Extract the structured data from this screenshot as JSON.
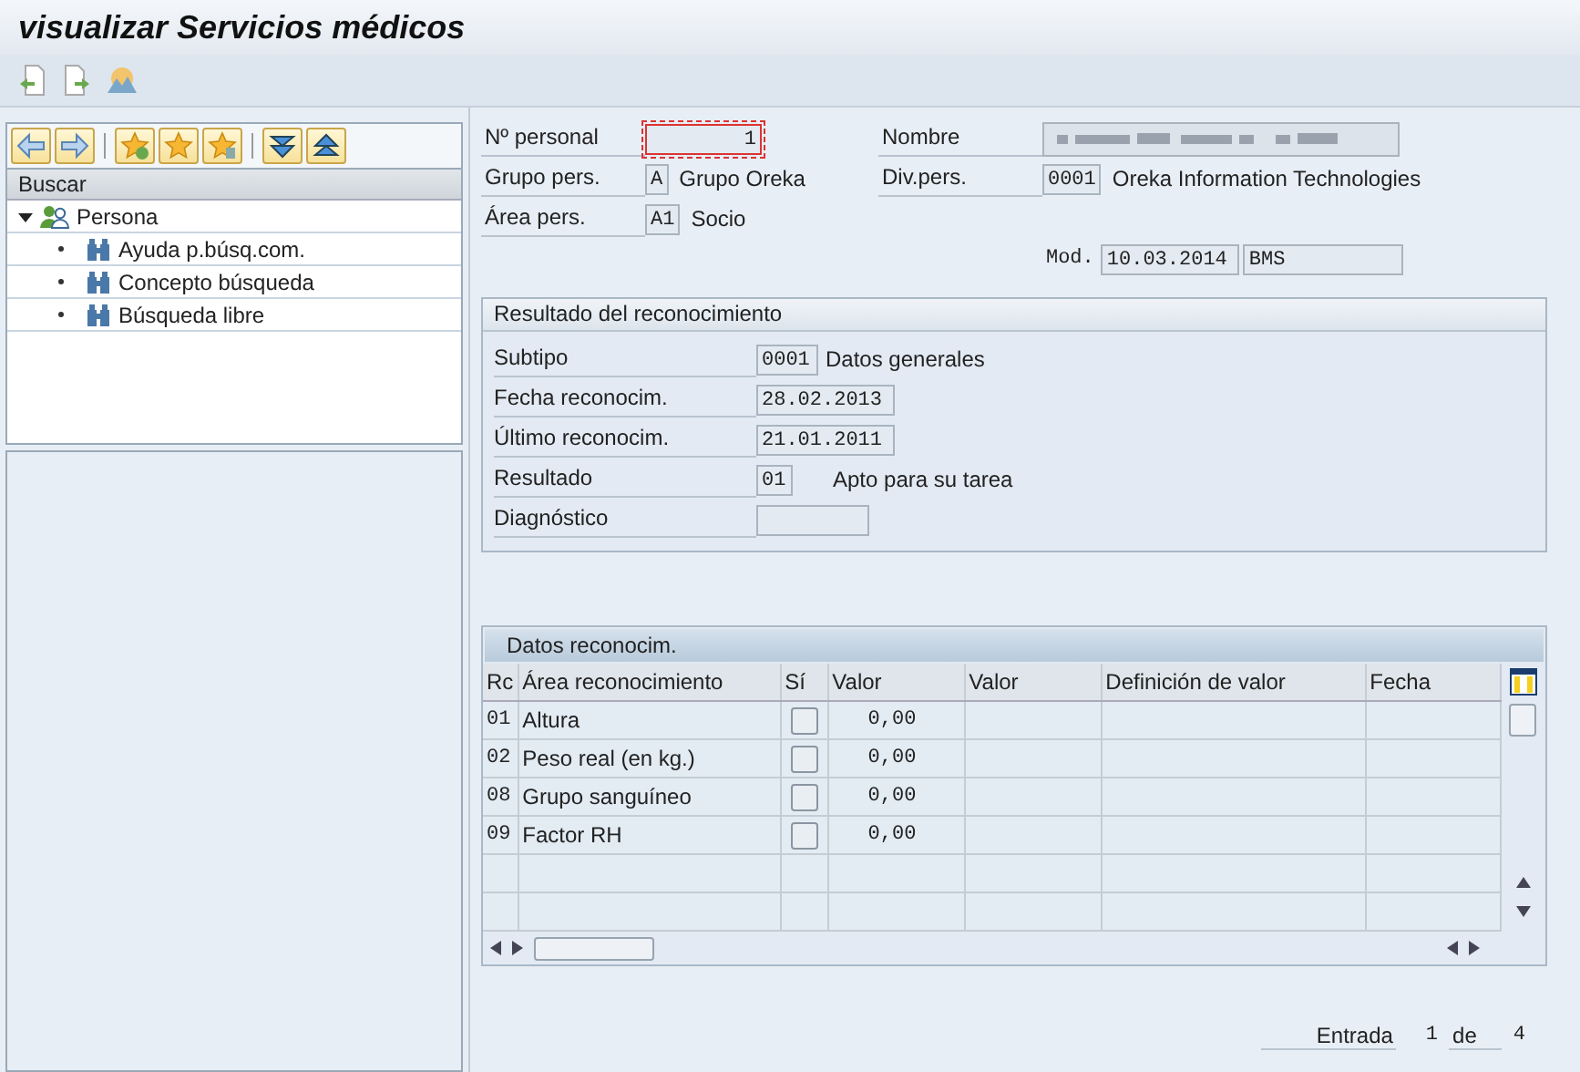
{
  "window": {
    "title": "visualizar Servicios médicos"
  },
  "search_panel": {
    "header": "Buscar",
    "tree": [
      {
        "label": "Persona",
        "expanded": true,
        "children": [
          {
            "label": "Ayuda p.búsq.com."
          },
          {
            "label": "Concepto búsqueda"
          },
          {
            "label": "Búsqueda libre"
          }
        ]
      }
    ]
  },
  "header": {
    "personnel_no": {
      "label": "Nº personal",
      "value": "1"
    },
    "name": {
      "label": "Nombre"
    },
    "group": {
      "label": "Grupo pers.",
      "value": "A",
      "text": "Grupo Oreka"
    },
    "division": {
      "label": "Div.pers.",
      "value": "0001",
      "text": "Oreka Information Technologies"
    },
    "area": {
      "label": "Área pers.",
      "value": "A1",
      "text": "Socio"
    },
    "modified": {
      "label": "Mod.",
      "date": "10.03.2014",
      "user": "BMS"
    }
  },
  "result_group": {
    "title": "Resultado del reconocimiento",
    "fields": [
      {
        "label": "Subtipo",
        "value": "0001",
        "text": "Datos generales"
      },
      {
        "label": "Fecha reconocim.",
        "value": "28.02.2013"
      },
      {
        "label": "Último reconocim.",
        "value": "21.01.2011"
      },
      {
        "label": "Resultado",
        "value": "01",
        "text": "Apto para su tarea"
      },
      {
        "label": "Diagnóstico"
      }
    ]
  },
  "table": {
    "title": "Datos reconocim.",
    "columns": [
      "Rc",
      "Área reconocimiento",
      "Sí",
      "Valor",
      "Valor",
      "Definición de valor",
      "Fecha"
    ],
    "rows": [
      {
        "rc": "01",
        "area": "Altura",
        "checked": false,
        "value": "0,00"
      },
      {
        "rc": "02",
        "area": "Peso real (en kg.)",
        "checked": false,
        "value": "0,00"
      },
      {
        "rc": "08",
        "area": "Grupo sanguíneo",
        "checked": false,
        "value": "0,00"
      },
      {
        "rc": "09",
        "area": "Factor RH",
        "checked": false,
        "value": "0,00"
      }
    ]
  },
  "footer": {
    "label": "Entrada",
    "current": "1",
    "of": "de",
    "total": "4"
  }
}
